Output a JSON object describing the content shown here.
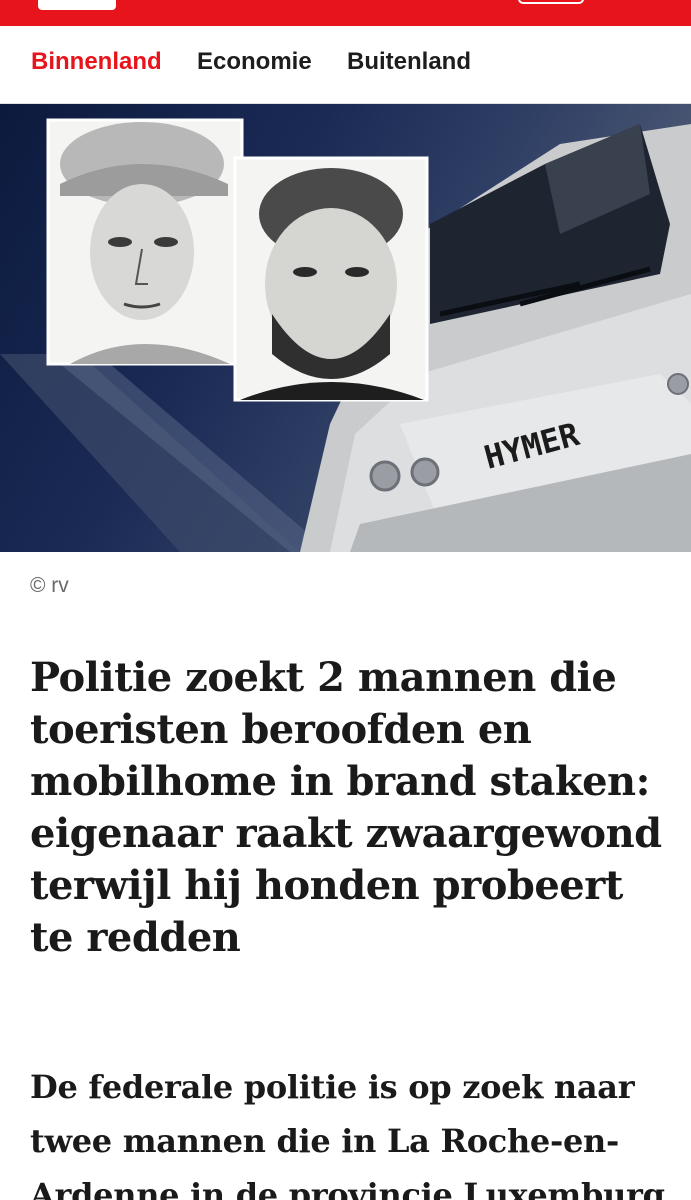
{
  "nav": {
    "tabs": [
      {
        "label": "Binnenland",
        "active": true
      },
      {
        "label": "Economie",
        "active": false
      },
      {
        "label": "Buitenland",
        "active": false
      }
    ]
  },
  "hero": {
    "vehicle_text": "HYMER"
  },
  "article": {
    "photo_credit": "© rv",
    "headline": "Politie zoekt 2 mannen die toeristen beroofden en mobilhome in brand staken: eigenaar raakt zwaargewond terwijl hij honden probeert te redden",
    "lead": "De federale politie is op zoek naar twee mannen die in La Roche-en-Ardenne in de provincie Luxemburg"
  },
  "colors": {
    "brand_red": "#e8141c",
    "text": "#1a1a1a",
    "muted": "#6a6a6a"
  }
}
